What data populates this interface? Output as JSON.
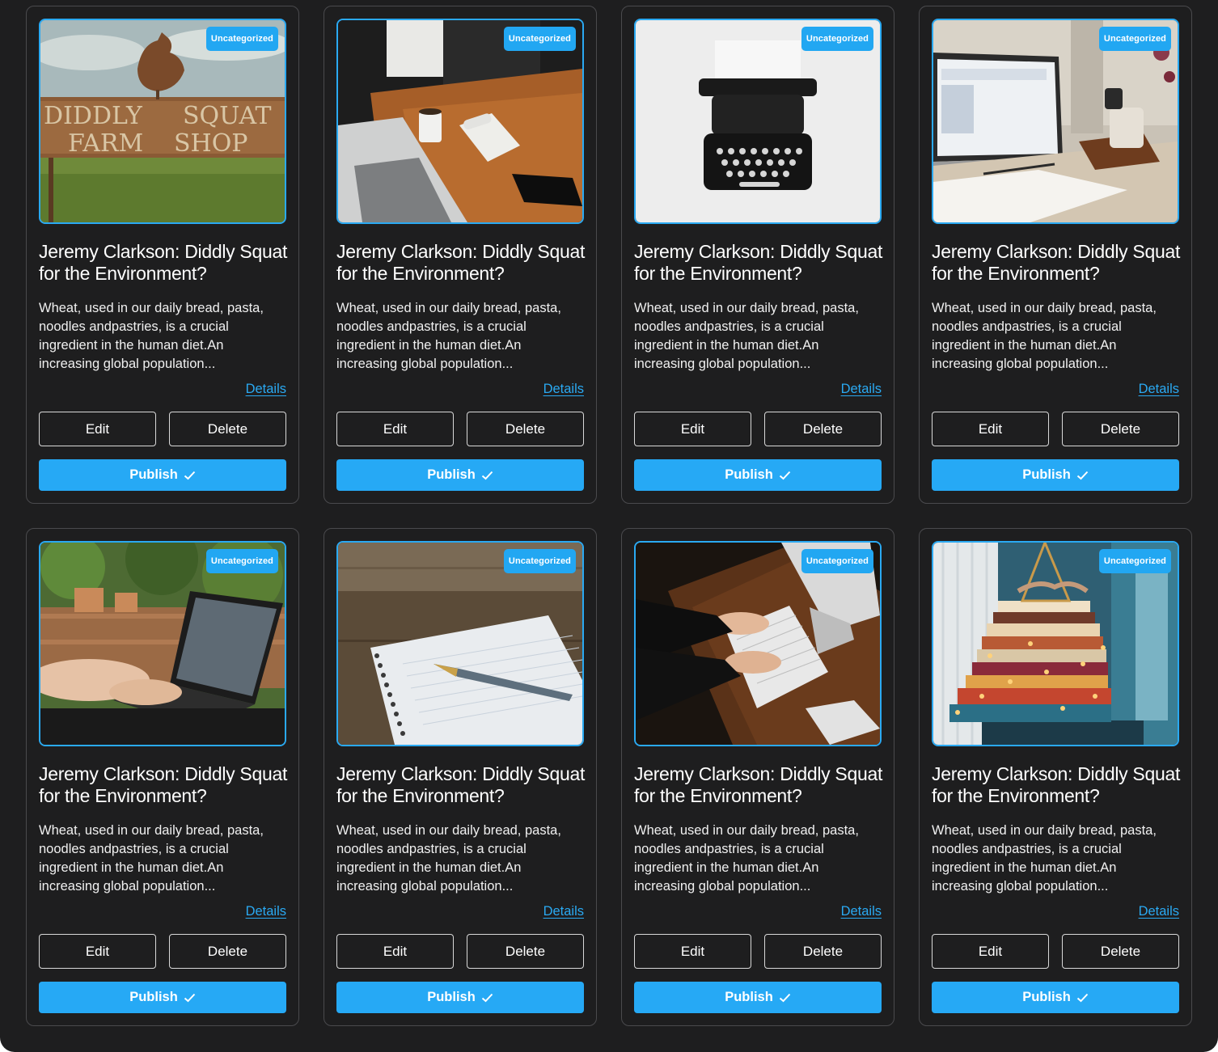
{
  "colors": {
    "page_background": "#1e1e1f",
    "accent": "#26a9f5",
    "card_border": "#4a4a4d"
  },
  "posts": [
    {
      "badge": "Uncategorized",
      "image": "farm-shop-sign-image",
      "title": "Jeremy Clarkson: Diddly Squat for the Environment?",
      "excerpt": "Wheat, used in our daily bread, pasta, noodles andpastries, is a crucial ingredient in the human diet.An increasing global population...",
      "details_label": "Details",
      "edit_label": "Edit",
      "delete_label": "Delete",
      "publish_label": "Publish",
      "publish_icon": "check-icon"
    },
    {
      "badge": "Uncategorized",
      "image": "laptop-coffee-desk-image",
      "title": "Jeremy Clarkson: Diddly Squat for the Environment?",
      "excerpt": "Wheat, used in our daily bread, pasta, noodles andpastries, is a crucial ingredient in the human diet.An increasing global population...",
      "details_label": "Details",
      "edit_label": "Edit",
      "delete_label": "Delete",
      "publish_label": "Publish",
      "publish_icon": "check-icon"
    },
    {
      "badge": "Uncategorized",
      "image": "typewriter-image",
      "title": "Jeremy Clarkson: Diddly Squat for the Environment?",
      "excerpt": "Wheat, used in our daily bread, pasta, noodles andpastries, is a crucial ingredient in the human diet.An increasing global population...",
      "details_label": "Details",
      "edit_label": "Edit",
      "delete_label": "Delete",
      "publish_label": "Publish",
      "publish_icon": "check-icon"
    },
    {
      "badge": "Uncategorized",
      "image": "laptop-notebook-mug-image",
      "title": "Jeremy Clarkson: Diddly Squat for the Environment?",
      "excerpt": "Wheat, used in our daily bread, pasta, noodles andpastries, is a crucial ingredient in the human diet.An increasing global population...",
      "details_label": "Details",
      "edit_label": "Edit",
      "delete_label": "Delete",
      "publish_label": "Publish",
      "publish_icon": "check-icon"
    },
    {
      "badge": "Uncategorized",
      "image": "hands-on-laptop-patio-image",
      "title": "Jeremy Clarkson: Diddly Squat for the Environment?",
      "excerpt": "Wheat, used in our daily bread, pasta, noodles andpastries, is a crucial ingredient in the human diet.An increasing global population...",
      "details_label": "Details",
      "edit_label": "Edit",
      "delete_label": "Delete",
      "publish_label": "Publish",
      "publish_icon": "check-icon"
    },
    {
      "badge": "Uncategorized",
      "image": "fountain-pen-notepad-image",
      "title": "Jeremy Clarkson: Diddly Squat for the Environment?",
      "excerpt": "Wheat, used in our daily bread, pasta, noodles andpastries, is a crucial ingredient in the human diet.An increasing global population...",
      "details_label": "Details",
      "edit_label": "Edit",
      "delete_label": "Delete",
      "publish_label": "Publish",
      "publish_icon": "check-icon"
    },
    {
      "badge": "Uncategorized",
      "image": "hands-on-keyboard-desk-image",
      "title": "Jeremy Clarkson: Diddly Squat for the Environment?",
      "excerpt": "Wheat, used in our daily bread, pasta, noodles andpastries, is a crucial ingredient in the human diet.An increasing global population...",
      "details_label": "Details",
      "edit_label": "Edit",
      "delete_label": "Delete",
      "publish_label": "Publish",
      "publish_icon": "check-icon"
    },
    {
      "badge": "Uncategorized",
      "image": "stacked-books-lights-image",
      "title": "Jeremy Clarkson: Diddly Squat for the Environment?",
      "excerpt": "Wheat, used in our daily bread, pasta, noodles andpastries, is a crucial ingredient in the human diet.An increasing global population...",
      "details_label": "Details",
      "edit_label": "Edit",
      "delete_label": "Delete",
      "publish_label": "Publish",
      "publish_icon": "check-icon"
    }
  ]
}
